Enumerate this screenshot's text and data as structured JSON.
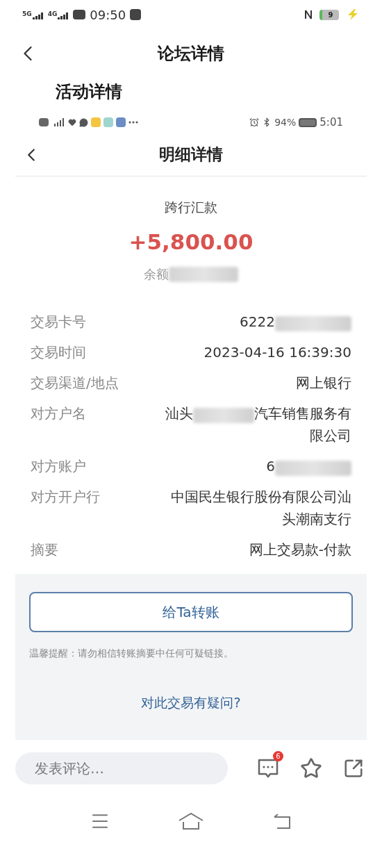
{
  "status_bar": {
    "network_labels": [
      "5G",
      "4G"
    ],
    "time": "09:50",
    "battery": "9"
  },
  "header": {
    "title": "论坛详情"
  },
  "section_title": "活动详情",
  "screenshot": {
    "status_bar": {
      "battery_percent": "94%",
      "time": "5:01"
    },
    "header": {
      "title": "明细详情"
    },
    "transaction_type": "跨行汇款",
    "amount": "+5,800.00",
    "balance_label": "余额",
    "details": [
      {
        "label": "交易卡号",
        "value": "6222",
        "redacted": true
      },
      {
        "label": "交易时间",
        "value": "2023-04-16 16:39:30",
        "redacted": false
      },
      {
        "label": "交易渠道/地点",
        "value": "网上银行",
        "redacted": false
      },
      {
        "label": "对方户名",
        "value": "汕头",
        "redacted": true,
        "value_rest": "汽车销售服务有限公司"
      },
      {
        "label": "对方账户",
        "value": "6",
        "redacted": true
      },
      {
        "label": "对方开户行",
        "value": "中国民生银行股份有限公司汕头潮南支行",
        "redacted": false
      },
      {
        "label": "摘要",
        "value": "网上交易款-付款",
        "redacted": false
      }
    ],
    "transfer_button": "给Ta转账",
    "warning": "温馨提醒：请勿相信转账摘要中任何可疑链接。",
    "question_link": "对此交易有疑问?"
  },
  "comment_bar": {
    "placeholder": "发表评论…",
    "badge": "6"
  }
}
